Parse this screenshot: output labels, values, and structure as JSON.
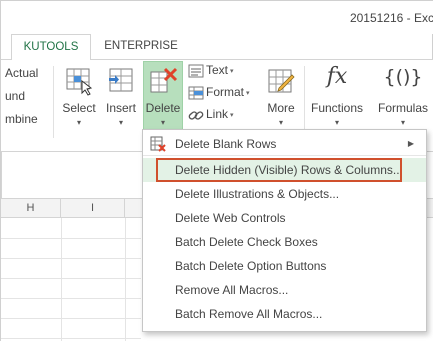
{
  "window": {
    "title": "20151216 - Exc"
  },
  "tabs": [
    {
      "label": "KUTOOLS",
      "active": true
    },
    {
      "label": "ENTERPRISE",
      "active": false
    }
  ],
  "ribbon": {
    "left_items": [
      "Actual",
      "und",
      "mbine"
    ],
    "buttons": {
      "select": "Select",
      "insert": "Insert",
      "delete": "Delete",
      "more": "More",
      "functions": "Functions",
      "formulas": "Formulas"
    },
    "small_buttons": {
      "text": "Text",
      "format": "Format",
      "link": "Link"
    },
    "icon_glyphs": {
      "functions": "fx",
      "formulas": "{()}"
    },
    "caret": "▾"
  },
  "sheet": {
    "columns": [
      "H",
      "I"
    ]
  },
  "delete_menu": {
    "items": [
      {
        "label": "Delete Blank Rows",
        "has_submenu": true
      },
      {
        "label": "Delete Hidden (Visible) Rows & Columns...",
        "highlighted": true
      },
      {
        "label": "Delete Illustrations & Objects..."
      },
      {
        "label": "Delete Web Controls"
      },
      {
        "label": "Batch Delete Check Boxes"
      },
      {
        "label": "Batch Delete Option Buttons"
      },
      {
        "label": "Remove All Macros..."
      },
      {
        "label": "Batch Remove All Macros..."
      }
    ]
  },
  "colors": {
    "accent_green": "#217346",
    "delete_button_bg": "#b7dfbd",
    "highlight_bg": "#e3f2e6",
    "highlight_outline": "#d0502d"
  }
}
